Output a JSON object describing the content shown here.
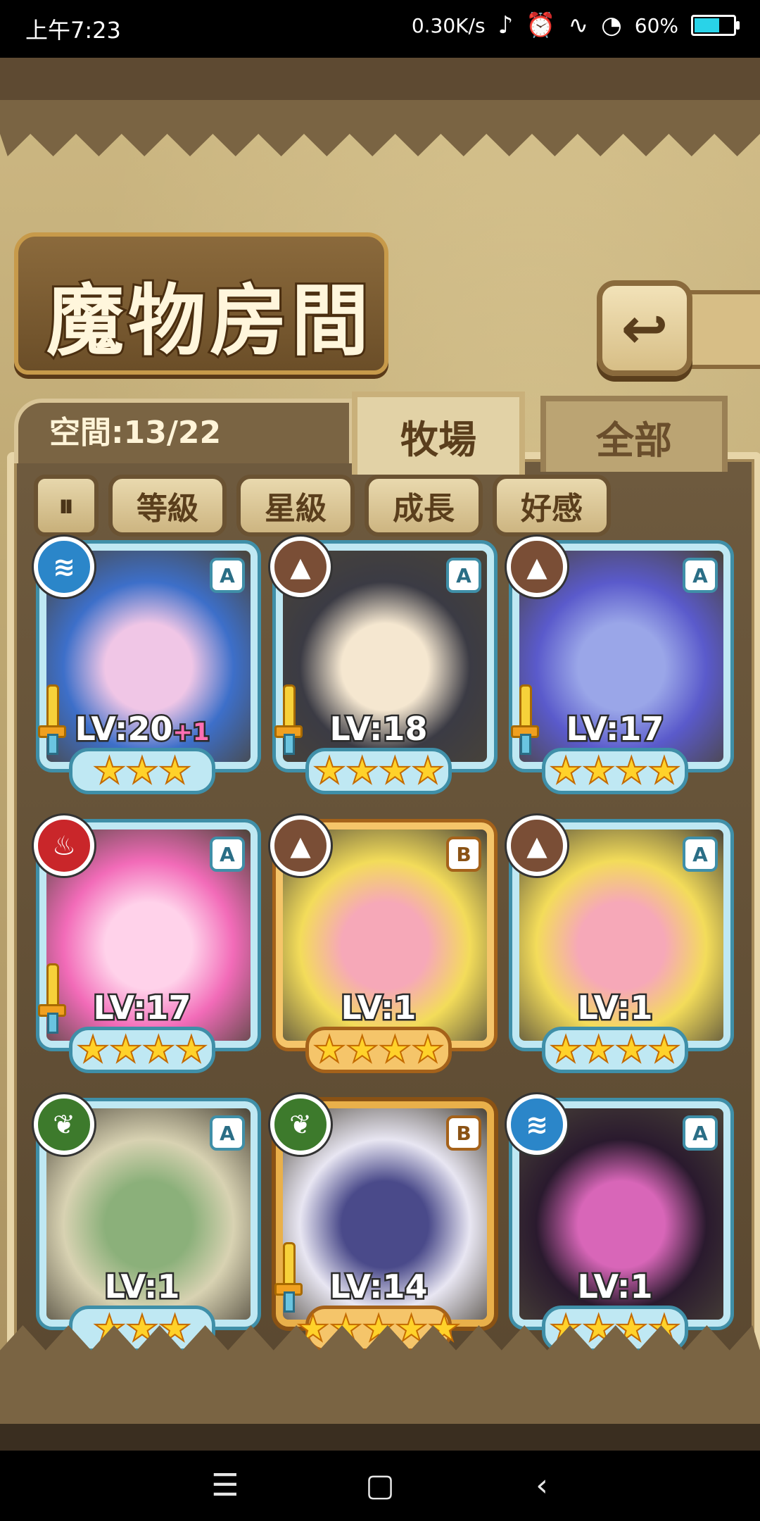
{
  "status_bar": {
    "time": "上午7:23",
    "net_speed": "0.30K/s",
    "battery_percent": "60%",
    "battery_level": 0.6
  },
  "header": {
    "title": "魔物房間",
    "back_icon": "back-arrow-icon"
  },
  "room": {
    "space_label": "空間:13/22"
  },
  "tabs": [
    {
      "label": "牧場",
      "selected": true
    },
    {
      "label": "全部",
      "selected": false
    }
  ],
  "sort": {
    "toggle_label": "⏸",
    "buttons": [
      "等級",
      "星級",
      "成長",
      "好感"
    ]
  },
  "colors": {
    "card_blue": "#bfe8f3",
    "card_gold": "#f5c56a",
    "element_water": "#2b86c9",
    "element_earth": "#7a4e36",
    "element_fire": "#c9262a",
    "element_wood": "#3d7a2c"
  },
  "monsters": [
    {
      "level": "LV:20",
      "bonus": "+1",
      "stars": "★★★",
      "rank": "A",
      "element": "water",
      "element_icon": "water-waves-icon",
      "weapon": true,
      "frame": "blue",
      "portrait": [
        "#3d6fc9",
        "#f0c6e6"
      ]
    },
    {
      "level": "LV:18",
      "bonus": "",
      "stars": "★★★★",
      "rank": "A",
      "element": "earth",
      "element_icon": "mountain-icon",
      "weapon": true,
      "frame": "blue",
      "portrait": [
        "#3b3b44",
        "#f5e7d0"
      ]
    },
    {
      "level": "LV:17",
      "bonus": "",
      "stars": "★★★★",
      "rank": "A",
      "element": "earth",
      "element_icon": "mountain-icon",
      "weapon": true,
      "frame": "blue",
      "portrait": [
        "#5a5acb",
        "#9aa6e8"
      ]
    },
    {
      "level": "LV:17",
      "bonus": "",
      "stars": "★★★★",
      "rank": "A",
      "element": "fire",
      "element_icon": "flame-icon",
      "weapon": true,
      "frame": "blue",
      "portrait": [
        "#f26bb8",
        "#ffd2ea"
      ]
    },
    {
      "level": "LV:1",
      "bonus": "",
      "stars": "★★★★",
      "rank": "B",
      "element": "earth",
      "element_icon": "mountain-icon",
      "weapon": false,
      "frame": "gold",
      "portrait": [
        "#f3dc5a",
        "#f6a8b8"
      ]
    },
    {
      "level": "LV:1",
      "bonus": "",
      "stars": "★★★★",
      "rank": "A",
      "element": "earth",
      "element_icon": "mountain-icon",
      "weapon": false,
      "frame": "blue",
      "portrait": [
        "#f3dc5a",
        "#f6a8b8"
      ]
    },
    {
      "level": "LV:1",
      "bonus": "",
      "stars": "★★★",
      "rank": "A",
      "element": "wood",
      "element_icon": "leaf-icon",
      "weapon": false,
      "frame": "blue",
      "portrait": [
        "#d8d2b2",
        "#8bb07a"
      ]
    },
    {
      "level": "LV:14",
      "bonus": "",
      "stars": "★★★★★",
      "rank": "B",
      "element": "wood",
      "element_icon": "leaf-icon",
      "weapon": true,
      "frame": "ornate",
      "portrait": [
        "#e8e6f2",
        "#4a4a8a"
      ]
    },
    {
      "level": "LV:1",
      "bonus": "",
      "stars": "★★★★",
      "rank": "A",
      "element": "water",
      "element_icon": "water-waves-icon",
      "weapon": false,
      "frame": "blue",
      "portrait": [
        "#2a1a2e",
        "#d866b8"
      ]
    }
  ],
  "nav": {
    "menu_icon": "menu-icon",
    "home_icon": "home-square-icon",
    "back_icon": "back-chevron-icon"
  }
}
